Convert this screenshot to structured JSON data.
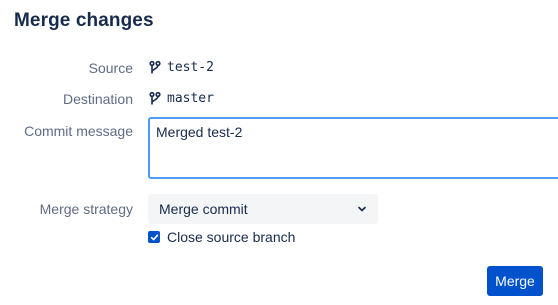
{
  "dialog": {
    "title": "Merge changes"
  },
  "form": {
    "source_label": "Source",
    "source_branch": "test-2",
    "destination_label": "Destination",
    "destination_branch": "master",
    "commit_label": "Commit message",
    "commit_value": "Merged test-2",
    "strategy_label": "Merge strategy",
    "strategy_value": "Merge commit",
    "close_branch_label": "Close source branch",
    "close_branch_checked": true
  },
  "actions": {
    "merge_label": "Merge"
  },
  "icons": {
    "branch": "branch-icon",
    "chevron": "chevron-down-icon",
    "check": "checkmark-icon"
  },
  "colors": {
    "primary": "#0052cc",
    "focus_border": "#4c9aff",
    "label_text": "#5e6c84",
    "body_text": "#172b4d",
    "select_bg": "#f4f5f7"
  }
}
